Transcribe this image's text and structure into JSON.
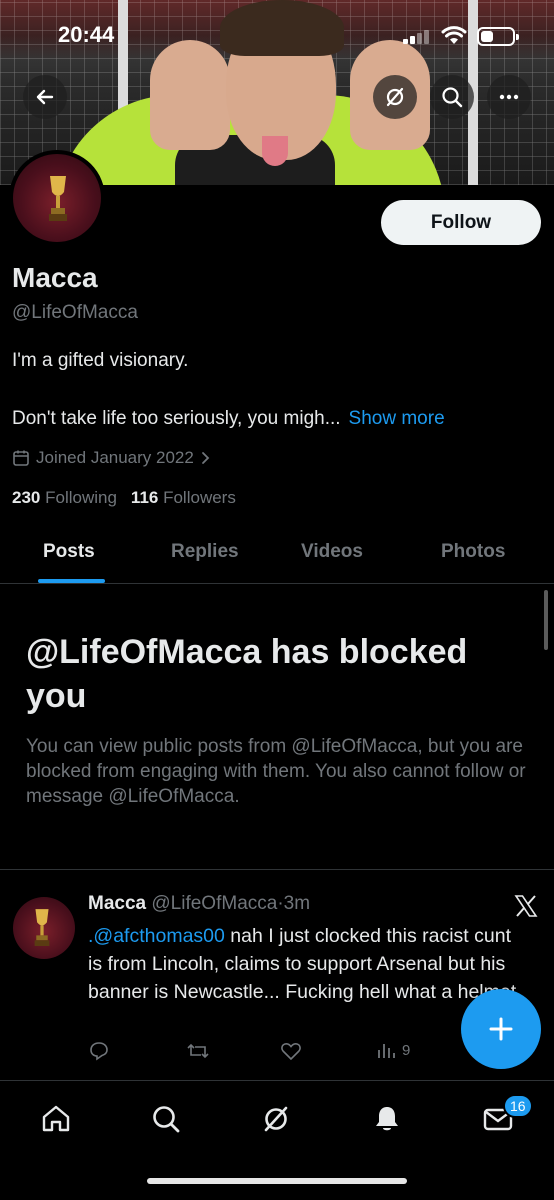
{
  "status_bar": {
    "time": "20:44"
  },
  "profile": {
    "name": "Macca",
    "handle": "@LifeOfMacca",
    "bio_line1": "I'm a gifted visionary.",
    "bio_line2": "Don't take life too seriously, you migh...",
    "show_more": "Show more",
    "joined": "Joined January 2022",
    "following_count": "230",
    "following_label": "Following",
    "followers_count": "116",
    "followers_label": "Followers",
    "follow_button": "Follow"
  },
  "tabs": [
    {
      "label": "Posts",
      "active": true
    },
    {
      "label": "Replies",
      "active": false
    },
    {
      "label": "Videos",
      "active": false
    },
    {
      "label": "Photos",
      "active": false
    }
  ],
  "blocked": {
    "title": "@LifeOfMacca has blocked you",
    "message": "You can view public posts from @LifeOfMacca, but you are blocked from engaging with them. You also cannot follow or message @LifeOfMacca."
  },
  "tweet": {
    "author": "Macca",
    "handle": "@LifeOfMacca",
    "time": "·3m",
    "mention": ".@afcthomas00",
    "text": " nah I just clocked this racist cunt is from Lincoln, claims to support Arsenal but his banner is Newcastle... Fucking hell what a helmet.",
    "views": "9"
  },
  "nav": {
    "messages_badge": "16"
  },
  "colors": {
    "accent": "#1d9bf0",
    "muted": "#71767b",
    "text": "#e7e9ea",
    "background": "#000000"
  }
}
